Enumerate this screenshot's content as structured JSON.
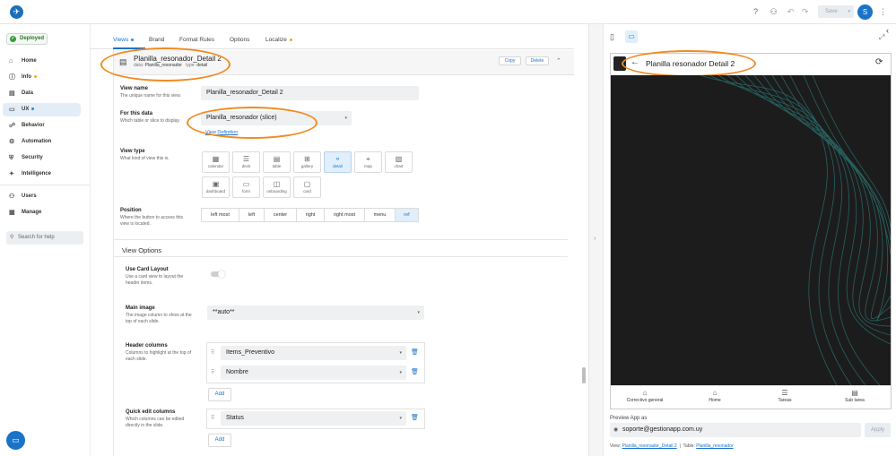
{
  "topbar": {
    "save_label": "Save",
    "avatar_initial": "S"
  },
  "sidebar": {
    "deployed_label": "Deployed",
    "items": [
      {
        "label": "Home",
        "icon": "home-icon"
      },
      {
        "label": "Info",
        "icon": "info-icon"
      },
      {
        "label": "Data",
        "icon": "data-icon"
      },
      {
        "label": "UX",
        "icon": "ux-icon"
      },
      {
        "label": "Behavior",
        "icon": "behavior-icon"
      },
      {
        "label": "Automation",
        "icon": "automation-icon"
      },
      {
        "label": "Security",
        "icon": "security-icon"
      },
      {
        "label": "Intelligence",
        "icon": "intelligence-icon"
      },
      {
        "label": "Users",
        "icon": "users-icon"
      },
      {
        "label": "Manage",
        "icon": "manage-icon"
      }
    ],
    "search_placeholder": "Search for help"
  },
  "tabs": [
    "Views",
    "Brand",
    "Format Rules",
    "Options",
    "Localize"
  ],
  "view": {
    "title": "Planilla_resonador_Detail 2",
    "data_label": "data:",
    "data_value": "Planilla_resonador",
    "type_label": "type:",
    "type_value": "detail",
    "copy_label": "Copy",
    "delete_label": "Delete"
  },
  "form": {
    "view_name_label": "View name",
    "view_name_hint": "The unique name for this view.",
    "view_name_value": "Planilla_resonador_Detail 2",
    "for_data_label": "For this data",
    "for_data_hint": "Which table or slice to display.",
    "for_data_value": "Planilla_resonador (slice)",
    "view_definition_link": "View Definition",
    "view_type_label": "View type",
    "view_type_hint": "What kind of view this is.",
    "view_types": [
      "calendar",
      "deck",
      "table",
      "gallery",
      "detail",
      "map",
      "chart",
      "dashboard",
      "form",
      "onboarding",
      "card"
    ],
    "position_label": "Position",
    "position_hint": "Where the button to access this view is located.",
    "positions": [
      "left most",
      "left",
      "center",
      "right",
      "right most",
      "menu",
      "ref"
    ],
    "view_options_title": "View Options",
    "card_layout_label": "Use Card Layout",
    "card_layout_hint": "Use a card view to layout the header items.",
    "main_image_label": "Main image",
    "main_image_hint": "The image column to show at the top of each slide.",
    "main_image_value": "**auto**",
    "header_columns_label": "Header columns",
    "header_columns_hint": "Columns to highlight at the top of each slide.",
    "header_columns": [
      "Items_Preventivo",
      "Nombre"
    ],
    "add_label": "Add",
    "quick_edit_label": "Quick edit columns",
    "quick_edit_hint": "Which columns can be edited directly in the slide.",
    "quick_edit_columns": [
      "Status"
    ]
  },
  "preview": {
    "phone_title": "Planilla resonador Detail 2",
    "bottom_nav": [
      "Correctivo general",
      "Home",
      "Tareas",
      "Sub tarea"
    ],
    "preview_as_label": "Preview App as",
    "preview_email": "soporte@gestionapp.com.uy",
    "apply_label": "Apply",
    "footer_view_label": "View:",
    "footer_view_value": "Planilla_resonador_Detail 2",
    "footer_sep": "|",
    "footer_table_label": "Table:",
    "footer_table_value": "Planilla_resonador"
  },
  "colors": {
    "accent": "#1a73c9",
    "highlight": "#f18a21",
    "preview_bg": "#1c1c1c"
  }
}
